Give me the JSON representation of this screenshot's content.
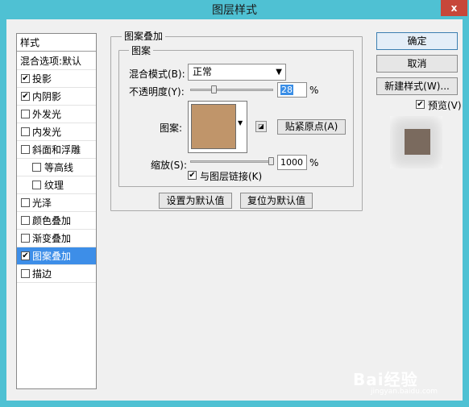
{
  "window": {
    "title": "图层样式",
    "close_label": "x"
  },
  "style_list": {
    "header": "样式",
    "blend_default": "混合选项:默认",
    "items": [
      {
        "label": "投影",
        "checked": true
      },
      {
        "label": "内阴影",
        "checked": true
      },
      {
        "label": "外发光",
        "checked": false
      },
      {
        "label": "内发光",
        "checked": false
      },
      {
        "label": "斜面和浮雕",
        "checked": false
      },
      {
        "label": "等高线",
        "checked": false
      },
      {
        "label": "纹理",
        "checked": false
      },
      {
        "label": "光泽",
        "checked": false
      },
      {
        "label": "颜色叠加",
        "checked": false
      },
      {
        "label": "渐变叠加",
        "checked": false
      },
      {
        "label": "图案叠加",
        "checked": true,
        "selected": true
      },
      {
        "label": "描边",
        "checked": false
      }
    ],
    "check_glyph": "✔"
  },
  "pattern_overlay": {
    "group_title": "图案叠加",
    "subgroup_title": "图案",
    "blend_mode_label": "混合模式(B):",
    "blend_mode_value": "正常",
    "opacity_label": "不透明度(Y):",
    "opacity_value": "28",
    "opacity_unit": "%",
    "pattern_label": "图案:",
    "snap_origin_button": "贴紧原点(A)",
    "scale_label": "缩放(S):",
    "scale_value": "1000",
    "scale_unit": "%",
    "link_layer_label": "与图层链接(K)",
    "link_layer_checked": true,
    "set_default_button": "设置为默认值",
    "reset_default_button": "复位为默认值",
    "pattern_color": "#c0956a"
  },
  "actions": {
    "ok": "确定",
    "cancel": "取消",
    "new_style": "新建样式(W)...",
    "preview_label": "预览(V)",
    "preview_checked": true
  },
  "watermark": {
    "brand": "Bai经验",
    "url": "jingyan.baidu.com"
  }
}
